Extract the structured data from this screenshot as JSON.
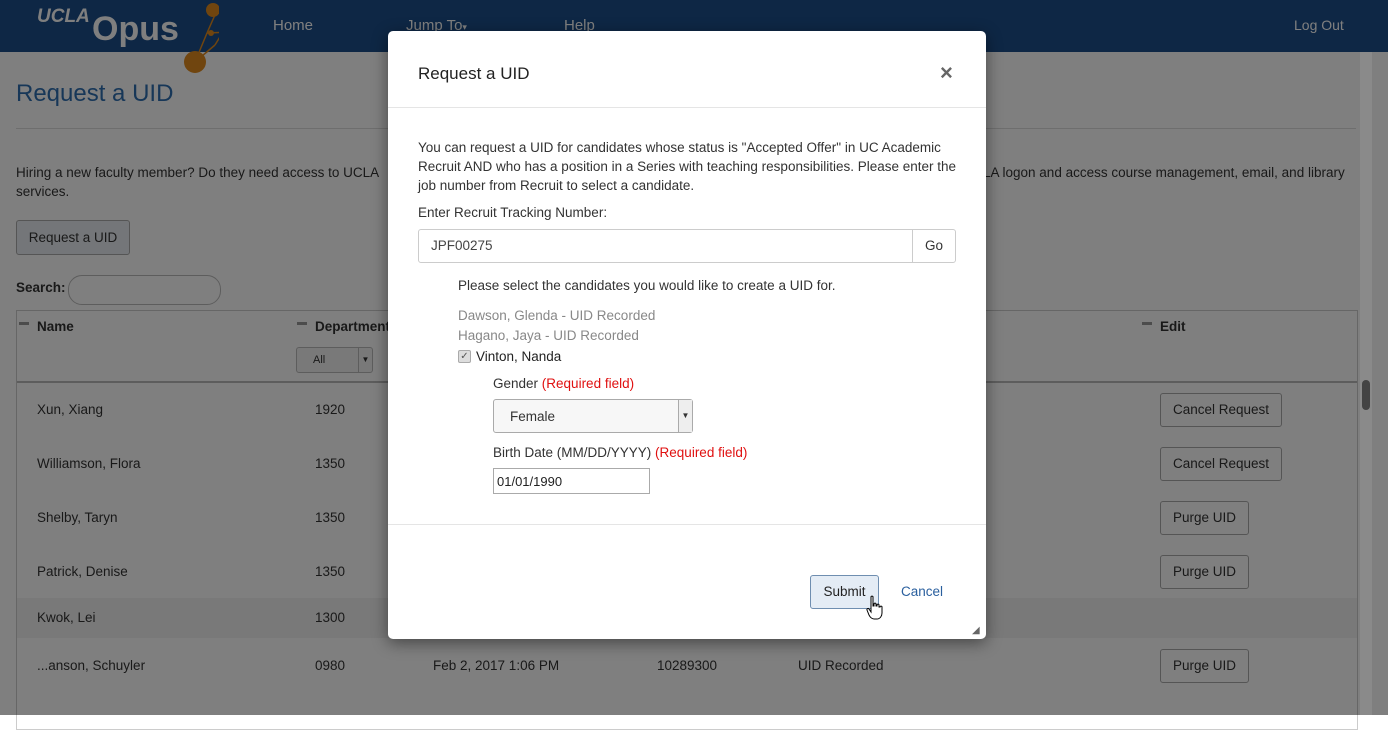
{
  "nav": {
    "logo_ucla": "UCLA",
    "logo_opus": "Opus",
    "home": "Home",
    "jump_to": "Jump To",
    "help": "Help",
    "logout": "Log Out"
  },
  "page": {
    "title": "Request a UID",
    "intro_left": "Hiring a new faculty member? Do they need access to UCLA services.",
    "intro_right": "LA logon and access course management, email, and library",
    "request_button": "Request a UID",
    "search_label": "Search:"
  },
  "table": {
    "headers": {
      "name": "Name",
      "department": "Department",
      "edit": "Edit"
    },
    "dept_filter": "All",
    "rows": [
      {
        "name": "Xun, Xiang",
        "dept": "1920",
        "date": "",
        "id": "",
        "status": "",
        "action": "Cancel Request"
      },
      {
        "name": "Williamson, Flora",
        "dept": "1350",
        "date": "",
        "id": "",
        "status": "",
        "action": "Cancel Request"
      },
      {
        "name": "Shelby, Taryn",
        "dept": "1350",
        "date": "",
        "id": "",
        "status": "",
        "action": "Purge UID"
      },
      {
        "name": "Patrick, Denise",
        "dept": "1350",
        "date": "",
        "id": "",
        "status": "",
        "action": "Purge UID"
      },
      {
        "name": "Kwok, Lei",
        "dept": "1300",
        "date": "",
        "id": "",
        "status": "",
        "action": ""
      },
      {
        "name": "...anson, Schuyler",
        "dept": "0980",
        "date": "Feb 2, 2017 1:06 PM",
        "id": "10289300",
        "status": "UID Recorded",
        "action": "Purge UID"
      }
    ]
  },
  "modal": {
    "title": "Request a UID",
    "close": "×",
    "description": "You can request a UID for candidates whose status is \"Accepted Offer\" in UC Academic Recruit AND who has a position in a Series with teaching responsibilities. Please enter the job number from Recruit to select a candidate.",
    "tracking_label": "Enter Recruit Tracking Number:",
    "tracking_value": "JPF00275",
    "go_button": "Go",
    "select_prompt": "Please select the candidates you would like to create a UID for.",
    "recorded_candidates": [
      "Dawson, Glenda - UID Recorded",
      "Hagano, Jaya - UID Recorded"
    ],
    "selected_candidate": "Vinton, Nanda",
    "gender_label": "Gender",
    "required_text": "(Required field)",
    "gender_value": "Female",
    "birth_label": "Birth Date (MM/DD/YYYY)",
    "birth_value": "01/01/1990",
    "submit_button": "Submit",
    "cancel_link": "Cancel"
  },
  "colors": {
    "navbar": "#1c4f8a",
    "logo_accent": "#e08a1e",
    "title_blue": "#2f6fb1",
    "required_red": "#e01010",
    "link_blue": "#2a5f9e"
  }
}
